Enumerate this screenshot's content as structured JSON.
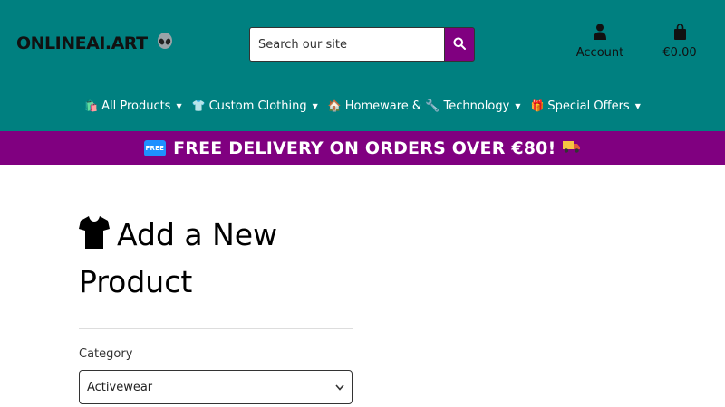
{
  "brand": {
    "name": "ONLINEAI.ART",
    "logo_icon": "alien-icon"
  },
  "search": {
    "placeholder": "Search our site",
    "value": ""
  },
  "account": {
    "label": "Account"
  },
  "cart": {
    "total": "€0.00"
  },
  "nav": [
    {
      "emoji": "🛍️",
      "label": "All Products"
    },
    {
      "emoji": "👕",
      "label": "Custom Clothing"
    },
    {
      "emoji": "🏠",
      "label": "Homeware & 🔧 Technology"
    },
    {
      "emoji": "🎁",
      "label": "Special Offers"
    }
  ],
  "banner": {
    "text": "FREE DELIVERY ON ORDERS OVER €80!",
    "tag": "FREE"
  },
  "page": {
    "title": "Add a New Product"
  },
  "form": {
    "category_label": "Category",
    "category_value": "Activewear"
  },
  "colors": {
    "header_bg": "#008080",
    "accent": "#800080"
  }
}
